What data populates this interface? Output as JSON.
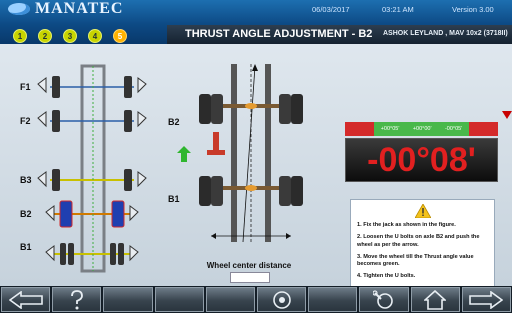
{
  "header": {
    "brand": "MANATEC",
    "date": "06/03/2017",
    "time": "03:21 AM",
    "version": "Version  3.00",
    "title": "THRUST ANGLE ADJUSTMENT - B2",
    "vehicle": "ASHOK LEYLAND , MAV 10x2 (3718II)",
    "steps": [
      {
        "label": "1",
        "active": false
      },
      {
        "label": "2",
        "active": false
      },
      {
        "label": "3",
        "active": false
      },
      {
        "label": "4",
        "active": false
      },
      {
        "label": "5",
        "active": true
      }
    ]
  },
  "axles": {
    "f1": "F1",
    "f2": "F2",
    "b3": "B3",
    "b2": "B2",
    "b1": "B1"
  },
  "detail_labels": {
    "b2": "B2",
    "b1": "B1"
  },
  "readout": {
    "tolerance_low": "+00°05'",
    "tolerance_mid": "+00°00'",
    "tolerance_high": "-00°05'",
    "value": "-00°08'",
    "status": "out-of-tolerance"
  },
  "instructions": {
    "steps": [
      "1. Fix the jack as shown in the figure.",
      "2. Loosen the U bolts on axle B2 and push the wheel as per the arrow.",
      "3. Move the wheel till the Thrust angle value becomes green.",
      "4. Tighten the U bolts."
    ]
  },
  "wheel_center_distance": {
    "label": "Wheel center distance",
    "value": ""
  },
  "footer": {
    "buttons": [
      {
        "icon": "back-arrow-icon"
      },
      {
        "icon": "help-icon"
      },
      {
        "icon": "empty"
      },
      {
        "icon": "empty"
      },
      {
        "icon": "empty"
      },
      {
        "icon": "adjust-wheel-icon"
      },
      {
        "icon": "empty"
      },
      {
        "icon": "wheel-wrench-icon"
      },
      {
        "icon": "home-icon"
      },
      {
        "icon": "forward-arrow-icon"
      }
    ]
  },
  "colors": {
    "header_blue": "#0d4a85",
    "step_green": "#c8d400",
    "step_active": "#ffb200",
    "value_red": "#e22020",
    "tol_green": "#49b84a",
    "tol_red": "#d42a2a"
  }
}
